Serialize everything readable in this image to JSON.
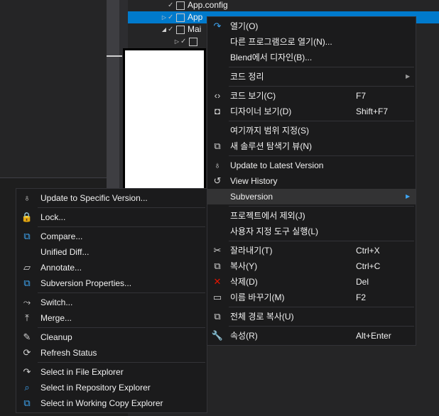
{
  "tree": {
    "rows": [
      {
        "label": "App.config",
        "arrow": "",
        "indent": 0
      },
      {
        "label": "App",
        "arrow": "▷",
        "indent": 0,
        "selected": true
      },
      {
        "label": "Mai",
        "arrow": "◢",
        "indent": 0
      },
      {
        "label": "",
        "arrow": "▷",
        "indent": 1
      }
    ]
  },
  "context_menu": {
    "items": [
      {
        "type": "item",
        "icon": "redo-arrow-icon",
        "glyph": "↷",
        "label": "열기(O)",
        "shortcut": ""
      },
      {
        "type": "item",
        "icon": "",
        "glyph": "",
        "label": "다른 프로그램으로 열기(N)...",
        "shortcut": ""
      },
      {
        "type": "item",
        "icon": "",
        "glyph": "",
        "label": "Blend에서 디자인(B)...",
        "shortcut": ""
      },
      {
        "type": "sep"
      },
      {
        "type": "item",
        "icon": "",
        "glyph": "",
        "label": "코드 정리",
        "shortcut": "",
        "submenu": true
      },
      {
        "type": "sep"
      },
      {
        "type": "item",
        "icon": "code-brackets-icon",
        "glyph": "‹›",
        "label": "코드 보기(C)",
        "shortcut": "F7"
      },
      {
        "type": "item",
        "icon": "designer-icon",
        "glyph": "◘",
        "label": "디자이너 보기(D)",
        "shortcut": "Shift+F7"
      },
      {
        "type": "sep"
      },
      {
        "type": "item",
        "icon": "",
        "glyph": "",
        "label": "여기까지 범위 지정(S)",
        "shortcut": ""
      },
      {
        "type": "item",
        "icon": "new-explorer-view-icon",
        "glyph": "⧉",
        "label": "새 솔루션 탐색기 뷰(N)",
        "shortcut": ""
      },
      {
        "type": "sep"
      },
      {
        "type": "item",
        "icon": "svn-update-icon",
        "glyph": "♁",
        "label": "Update to Latest Version",
        "shortcut": ""
      },
      {
        "type": "item",
        "icon": "history-icon",
        "glyph": "↺",
        "label": "View History",
        "shortcut": ""
      },
      {
        "type": "item",
        "icon": "",
        "glyph": "",
        "label": "Subversion",
        "shortcut": "",
        "submenu": true,
        "highlighted": true
      },
      {
        "type": "sep"
      },
      {
        "type": "item",
        "icon": "",
        "glyph": "",
        "label": "프로젝트에서 제외(J)",
        "shortcut": ""
      },
      {
        "type": "item",
        "icon": "",
        "glyph": "",
        "label": "사용자 지정 도구 실행(L)",
        "shortcut": ""
      },
      {
        "type": "sep"
      },
      {
        "type": "item",
        "icon": "scissors-icon",
        "glyph": "✂",
        "label": "잘라내기(T)",
        "shortcut": "Ctrl+X"
      },
      {
        "type": "item",
        "icon": "copy-icon",
        "glyph": "⧉",
        "label": "복사(Y)",
        "shortcut": "Ctrl+C"
      },
      {
        "type": "item",
        "icon": "delete-x-icon",
        "glyph": "✕",
        "label": "삭제(D)",
        "shortcut": "Del",
        "red": true
      },
      {
        "type": "item",
        "icon": "rename-icon",
        "glyph": "▭",
        "label": "이름 바꾸기(M)",
        "shortcut": "F2"
      },
      {
        "type": "sep"
      },
      {
        "type": "item",
        "icon": "copy-full-path-icon",
        "glyph": "⧉",
        "label": "전체 경로 복사(U)",
        "shortcut": ""
      },
      {
        "type": "sep"
      },
      {
        "type": "item",
        "icon": "wrench-icon",
        "glyph": "🔧",
        "label": "속성(R)",
        "shortcut": "Alt+Enter"
      }
    ]
  },
  "subversion_menu": {
    "items": [
      {
        "type": "item",
        "icon": "update-specific-version-icon",
        "glyph": "♁",
        "label": "Update to Specific Version..."
      },
      {
        "type": "sep"
      },
      {
        "type": "item",
        "icon": "lock-icon",
        "glyph": "🔒",
        "label": "Lock..."
      },
      {
        "type": "sep"
      },
      {
        "type": "item",
        "icon": "compare-icon",
        "glyph": "⧉",
        "label": "Compare...",
        "blue": true
      },
      {
        "type": "item",
        "icon": "",
        "glyph": "",
        "label": "Unified Diff..."
      },
      {
        "type": "item",
        "icon": "annotate-icon",
        "glyph": "▱",
        "label": "Annotate..."
      },
      {
        "type": "item",
        "icon": "svn-properties-icon",
        "glyph": "⧉",
        "label": "Subversion Properties...",
        "blue": true
      },
      {
        "type": "sep"
      },
      {
        "type": "item",
        "icon": "switch-icon",
        "glyph": "⤳",
        "label": "Switch..."
      },
      {
        "type": "item",
        "icon": "merge-icon",
        "glyph": "⤒",
        "label": "Merge..."
      },
      {
        "type": "sep"
      },
      {
        "type": "item",
        "icon": "cleanup-broom-icon",
        "glyph": "✎",
        "label": "Cleanup"
      },
      {
        "type": "item",
        "icon": "refresh-icon",
        "glyph": "⟳",
        "label": "Refresh Status"
      },
      {
        "type": "sep"
      },
      {
        "type": "item",
        "icon": "select-file-explorer-icon",
        "glyph": "↷",
        "label": "Select in File Explorer"
      },
      {
        "type": "item",
        "icon": "select-repo-explorer-icon",
        "glyph": "⌕",
        "label": "Select in Repository Explorer",
        "blue": true
      },
      {
        "type": "item",
        "icon": "select-working-copy-icon",
        "glyph": "⧉",
        "label": "Select in Working Copy Explorer",
        "blue": true
      }
    ]
  }
}
